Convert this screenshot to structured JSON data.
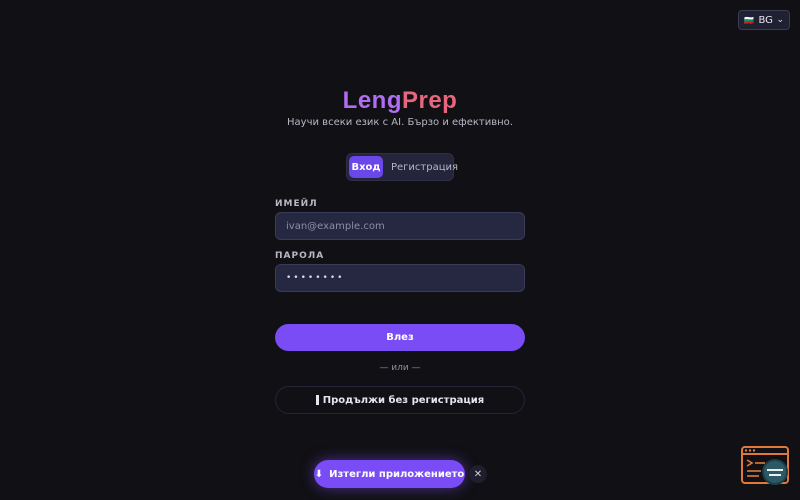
{
  "language_select": {
    "flag": "🇧🇬",
    "value": "BG"
  },
  "brand": {
    "part1": "Leng",
    "part2": "Prep"
  },
  "tagline": "Научи всеки език с AI. Бързо и ефективно.",
  "tabs": [
    {
      "label": "Вход",
      "active": true
    },
    {
      "label": "Регистрация",
      "active": false
    }
  ],
  "form": {
    "email_label": "ИМЕЙЛ",
    "email_placeholder": "ivan@example.com",
    "password_label": "ПАРОЛА",
    "password_value": "••••••••",
    "submit_label": "Влез"
  },
  "divider": "— или —",
  "guest_button": {
    "label": "Продължи без регистрация"
  },
  "download_banner": {
    "label": "Изтегли приложението"
  },
  "colors": {
    "accent": "#7a4cf5",
    "background": "#111014",
    "brand_purple": "#b06cf2",
    "brand_coral": "#e8667d"
  }
}
